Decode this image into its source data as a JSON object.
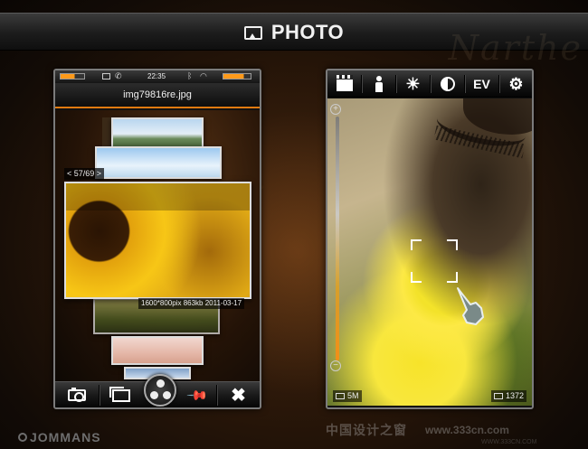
{
  "header": {
    "title": "PHOTO",
    "brand_script": "Narthe",
    "icon": "picture-icon"
  },
  "left_phone": {
    "status": {
      "time": "22:35",
      "signal_level": 0.6,
      "battery_level": 0.75
    },
    "file_name": "img79816re.jpg",
    "counter": "< 57/69 >",
    "photo_info": "1600*800pix  863kb  2011-03-17",
    "toolbar": [
      {
        "name": "camera",
        "icon": "camera-icon"
      },
      {
        "name": "gallery",
        "icon": "gallery-icon"
      },
      {
        "name": "reel",
        "icon": "film-reel-icon"
      },
      {
        "name": "pin",
        "icon": "pin-icon"
      },
      {
        "name": "close",
        "icon": "close-icon",
        "glyph": "✖"
      }
    ]
  },
  "right_phone": {
    "toolbar": [
      {
        "name": "scene",
        "icon": "clapperboard-icon"
      },
      {
        "name": "portrait",
        "icon": "person-icon"
      },
      {
        "name": "white-balance",
        "icon": "sun-icon",
        "glyph": "☀"
      },
      {
        "name": "contrast",
        "icon": "contrast-icon"
      },
      {
        "name": "ev",
        "label": "EV"
      },
      {
        "name": "settings",
        "icon": "gear-icon",
        "glyph": "⚙"
      }
    ],
    "zoom": {
      "plus": "+",
      "minus": "−",
      "level": 0.45
    },
    "resolution": "5M",
    "shots_remaining": "1372"
  },
  "footer": {
    "brand": "JOMMANS",
    "watermark": "中国设计之窗",
    "watermark_url": "www.333cn.com",
    "fine_print": "WWW.333CN.COM"
  },
  "colors": {
    "accent": "#e07a10",
    "background": "#2a1709"
  }
}
